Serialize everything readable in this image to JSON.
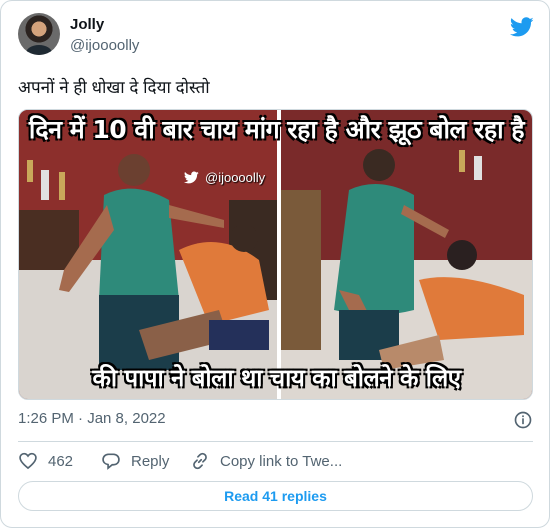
{
  "author": {
    "name": "Jolly",
    "handle": "@ijoooolly"
  },
  "tweet": {
    "text": "अपनों ने ही धोखा दे दिया दोस्तो",
    "timestamp": "1:26 PM · Jan 8, 2022"
  },
  "media": {
    "top_caption": "दिन में 10 वी बार चाय मांग रहा है और झूठ बोल रहा है",
    "bottom_caption": "की पापा ने बोला था चाय का बोलने के लिए",
    "watermark": "@ijoooolly"
  },
  "actions": {
    "like_count": "462",
    "reply_label": "Reply",
    "copy_link_label": "Copy link to Twe..."
  },
  "read_replies_label": "Read 41 replies",
  "colors": {
    "twitter_blue": "#1d9bf0",
    "secondary_text": "#536471",
    "border": "#cfd9de"
  },
  "icons": [
    "twitter-bird-icon",
    "info-icon",
    "heart-icon",
    "reply-bubble-icon",
    "link-icon"
  ]
}
